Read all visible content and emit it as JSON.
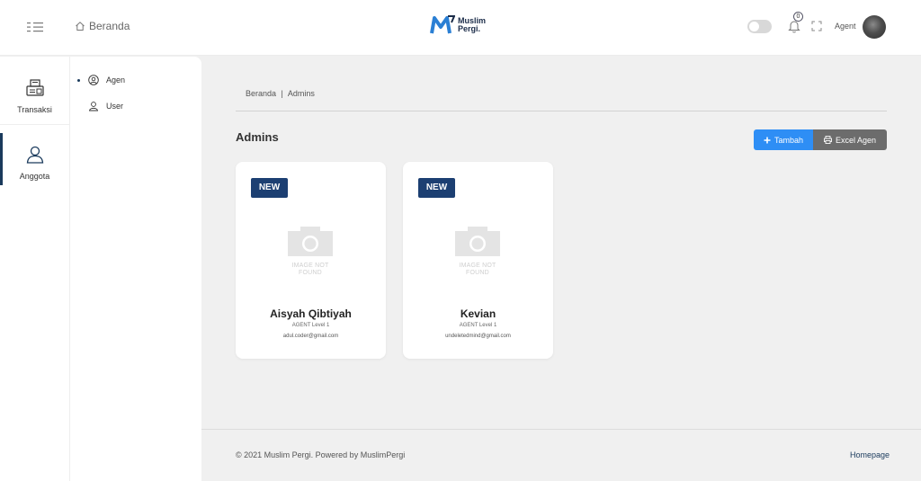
{
  "header": {
    "home_label": "Beranda",
    "logo_text": "Muslim Pergi.",
    "notification_count": "0",
    "user_label": "Agent",
    "icons": [
      "menu-icon",
      "home-icon",
      "toggle-switch",
      "bell-icon",
      "fullscreen-icon",
      "avatar"
    ]
  },
  "sidebar": {
    "items": [
      {
        "label": "Transaksi",
        "icon": "fax-icon"
      },
      {
        "label": "Anggota",
        "icon": "user-icon",
        "active": true
      }
    ]
  },
  "subnav": {
    "items": [
      {
        "label": "Agen",
        "icon": "user-circle-icon",
        "active": true
      },
      {
        "label": "User",
        "icon": "user-outline-icon"
      }
    ]
  },
  "breadcrumb": {
    "home": "Beranda",
    "separator": "|",
    "current": "Admins"
  },
  "page": {
    "title": "Admins",
    "add_button": "Tambah",
    "export_button": "Excel Agen"
  },
  "cards": [
    {
      "badge": "NEW",
      "placeholder": "IMAGE NOT FOUND",
      "name": "Aisyah Qibtiyah",
      "role": "AGENT Level 1",
      "email": "adul.coder@gmail.com"
    },
    {
      "badge": "NEW",
      "placeholder": "IMAGE NOT FOUND",
      "name": "Kevian",
      "role": "AGENT Level 1",
      "email": "undeletedmind@gmail.com"
    }
  ],
  "footer": {
    "copyright": "© 2021 Muslim Pergi. Powered by MuslimPergi",
    "link": "Homepage"
  },
  "colors": {
    "brand_dark": "#1c3f72",
    "primary_button": "#2e8ef5",
    "secondary_button": "#6c6c6c",
    "logo_blue": "#2a7fd4"
  }
}
